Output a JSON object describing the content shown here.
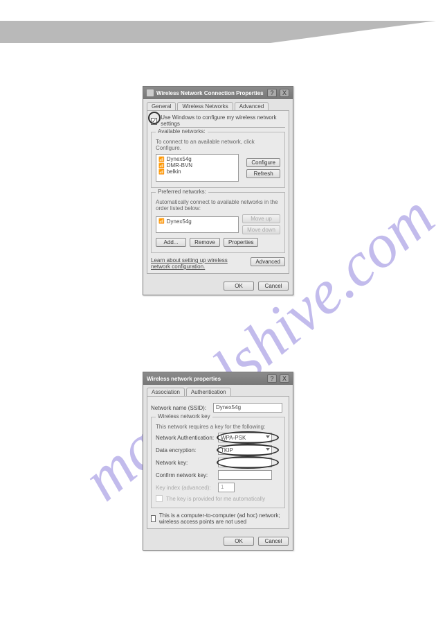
{
  "watermark": "manualshive.com",
  "dialog1": {
    "title": "Wireless Network Connection Properties",
    "tabs": {
      "general": "General",
      "wireless": "Wireless Networks",
      "advanced": "Advanced"
    },
    "use_windows": "Use Windows to configure my wireless network settings",
    "available": {
      "legend": "Available networks:",
      "hint": "To connect to an available network, click Configure.",
      "items": [
        "Dynex54g",
        "DMR-BVN",
        "belkin"
      ],
      "configure": "Configure",
      "refresh": "Refresh"
    },
    "preferred": {
      "legend": "Preferred networks:",
      "hint": "Automatically connect to available networks in the order listed below:",
      "items": [
        "Dynex54g"
      ],
      "moveup": "Move up",
      "movedown": "Move down",
      "add": "Add...",
      "remove": "Remove",
      "properties": "Properties"
    },
    "learn": "Learn about setting up wireless network configuration.",
    "advanced_btn": "Advanced",
    "ok": "OK",
    "cancel": "Cancel"
  },
  "dialog2": {
    "title": "Wireless network properties",
    "tabs": {
      "assoc": "Association",
      "auth": "Authentication"
    },
    "ssid_label": "Network name (SSID):",
    "ssid_value": "Dynex54g",
    "key_legend": "Wireless network key",
    "key_hint": "This network requires a key for the following:",
    "auth_label": "Network Authentication:",
    "auth_value": "WPA-PSK",
    "enc_label": "Data encryption:",
    "enc_value": "TKIP",
    "netkey_label": "Network key:",
    "confirm_label": "Confirm network key:",
    "index_label": "Key index (advanced):",
    "index_value": "1",
    "auto_label": "The key is provided for me automatically",
    "adhoc_label": "This is a computer-to-computer (ad hoc) network; wireless access points are not used",
    "ok": "OK",
    "cancel": "Cancel"
  }
}
